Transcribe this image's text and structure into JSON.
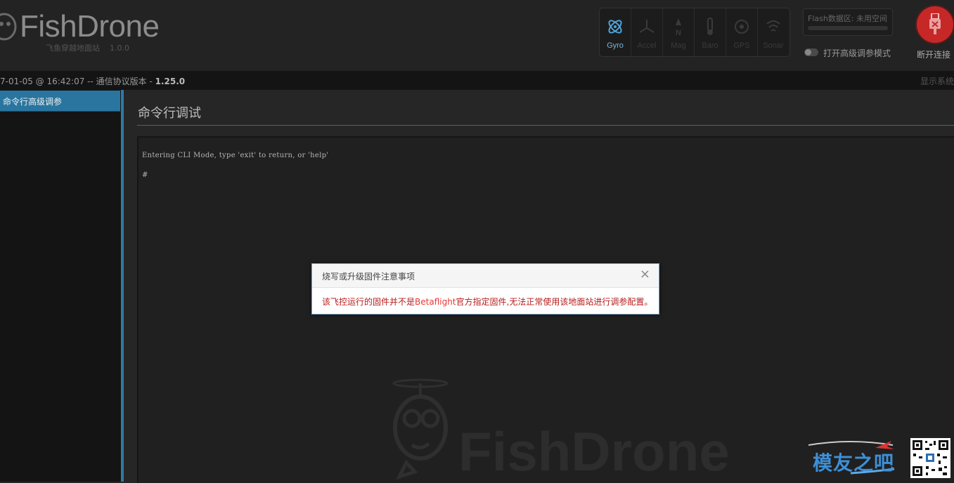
{
  "app": {
    "logo_text": "FishDrone",
    "subtitle": "飞鱼穿越地面站",
    "version": "1.0.0"
  },
  "sensors": [
    {
      "name": "Gyro",
      "icon": "gyro-icon",
      "active": true
    },
    {
      "name": "Accel",
      "icon": "accel-icon",
      "active": false
    },
    {
      "name": "Mag",
      "icon": "mag-icon",
      "active": false
    },
    {
      "name": "Baro",
      "icon": "baro-icon",
      "active": false
    },
    {
      "name": "GPS",
      "icon": "gps-icon",
      "active": false
    },
    {
      "name": "Sonar",
      "icon": "sonar-icon",
      "active": false
    }
  ],
  "flash": {
    "label": "Flash数据区: 未用空间"
  },
  "expert_mode": {
    "label": "打开高级调参模式",
    "enabled": false
  },
  "connect": {
    "label": "断开连接",
    "icon": "usb-disconnect-icon",
    "color": "#c62828"
  },
  "statusbar": {
    "timestamp": "7-01-05 @ 16:42:07",
    "protocol_prefix": " -- 通信协议版本 - ",
    "protocol_version": "1.25.0",
    "right_text": "显示系统"
  },
  "sidebar": {
    "items": [
      {
        "label": "命令行高级调参",
        "active": true
      }
    ]
  },
  "main": {
    "title": "命令行调试",
    "console_lines": [
      "Entering CLI Mode, type 'exit' to return, or 'help'",
      "#"
    ],
    "watermark": "FishDrone"
  },
  "modal": {
    "title": "烧写或升级固件注意事项",
    "close": "×",
    "message_before": "该飞控运行的固件并不是",
    "brand": "Betaflight",
    "message_after": "官方指定固件,无法正常使用该地面站进行调参配置。"
  },
  "site_watermark": {
    "text": "模友之吧"
  },
  "colors": {
    "accent": "#2e7aa3",
    "alert": "#b71c1c"
  }
}
